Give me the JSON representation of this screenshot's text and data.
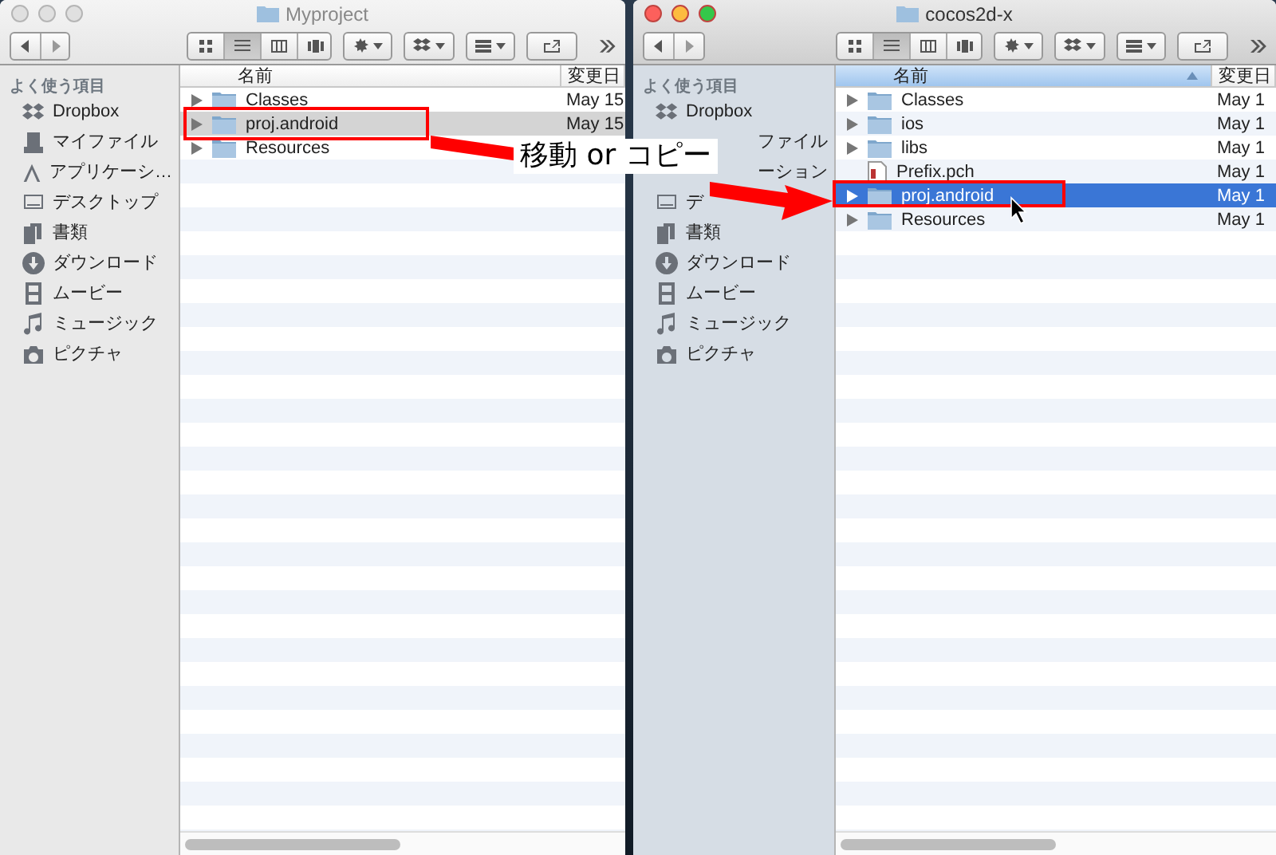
{
  "windows": [
    {
      "title": "Myproject",
      "active": false,
      "sidebar": {
        "heading": "よく使う項目",
        "items": [
          {
            "label": "Dropbox",
            "kind": "dropbox",
            "covered": false
          },
          {
            "label": "マイファイル",
            "kind": "files",
            "covered": false
          },
          {
            "label": "アプリケーシ…",
            "kind": "apps",
            "covered": false
          },
          {
            "label": "デスクトップ",
            "kind": "desktop",
            "covered": false
          },
          {
            "label": "書類",
            "kind": "documents",
            "covered": false
          },
          {
            "label": "ダウンロード",
            "kind": "downloads",
            "covered": false
          },
          {
            "label": "ムービー",
            "kind": "movies",
            "covered": false
          },
          {
            "label": "ミュージック",
            "kind": "music",
            "covered": false
          },
          {
            "label": "ピクチャ",
            "kind": "pictures",
            "covered": false
          }
        ]
      },
      "columns": [
        {
          "label": "名前",
          "sorted": false
        },
        {
          "label": "変更日",
          "sorted": false
        }
      ],
      "rows": [
        {
          "name": "Classes",
          "kind": "folder",
          "expandable": true,
          "date": "May 15",
          "selected": false
        },
        {
          "name": "proj.android",
          "kind": "folder",
          "expandable": true,
          "date": "May 15",
          "selected": true
        },
        {
          "name": "Resources",
          "kind": "folder",
          "expandable": true,
          "date": "",
          "selected": false
        }
      ]
    },
    {
      "title": "cocos2d-x",
      "active": true,
      "sidebar": {
        "heading": "よく使う項目",
        "items": [
          {
            "label": "Dropbox",
            "kind": "dropbox",
            "covered": false
          },
          {
            "label": "ファイル",
            "covered": true
          },
          {
            "label": "ーション",
            "covered": true
          },
          {
            "label": "デ",
            "kind": "desktop",
            "covered": false
          },
          {
            "label": "書類",
            "kind": "documents",
            "covered": false
          },
          {
            "label": "ダウンロード",
            "kind": "downloads",
            "covered": false
          },
          {
            "label": "ムービー",
            "kind": "movies",
            "covered": false
          },
          {
            "label": "ミュージック",
            "kind": "music",
            "covered": false
          },
          {
            "label": "ピクチャ",
            "kind": "pictures",
            "covered": false
          }
        ]
      },
      "columns": [
        {
          "label": "名前",
          "sorted": true
        },
        {
          "label": "変更日",
          "sorted": false
        }
      ],
      "rows": [
        {
          "name": "Classes",
          "kind": "folder",
          "expandable": true,
          "date": "May 1",
          "selected": false
        },
        {
          "name": "ios",
          "kind": "folder",
          "expandable": true,
          "date": "May 1",
          "selected": false
        },
        {
          "name": "libs",
          "kind": "folder",
          "expandable": true,
          "date": "May 1",
          "selected": false
        },
        {
          "name": "Prefix.pch",
          "kind": "file",
          "expandable": false,
          "date": "May 1",
          "selected": false
        },
        {
          "name": "proj.android",
          "kind": "folder",
          "expandable": true,
          "date": "May 1",
          "selected": true
        },
        {
          "name": "Resources",
          "kind": "folder",
          "expandable": true,
          "date": "May 1",
          "selected": false
        }
      ]
    }
  ],
  "annotation": {
    "label": "移動 or コピー"
  }
}
